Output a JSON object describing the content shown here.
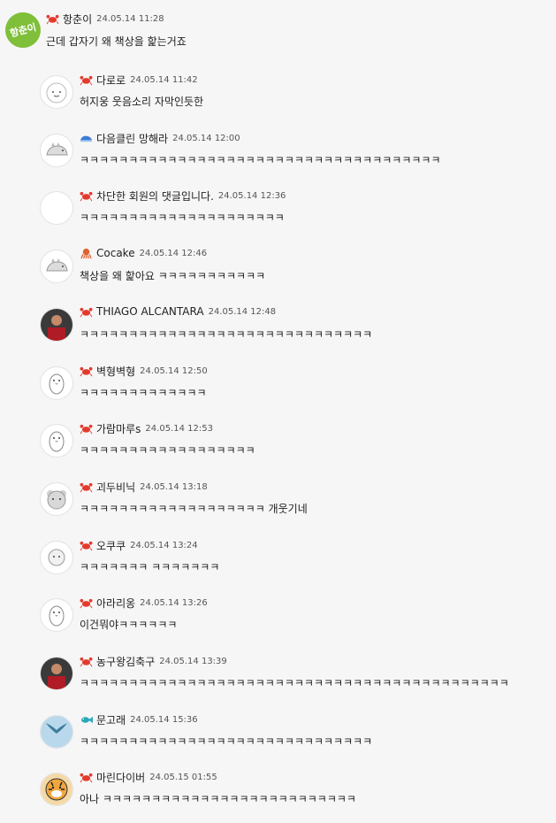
{
  "root": {
    "nick": "항춘이",
    "time": "24.05.14 11:28",
    "text": "근데 갑자기 왜 책상을 핥는거죠",
    "avatar_text": "항춘이",
    "badge": "crab-icon"
  },
  "replies": [
    {
      "nick": "다로로",
      "time": "24.05.14 11:42",
      "text": "허지웅 웃음소리 자막인듯한",
      "badge": "crab-icon",
      "avatar": "default-face-avatar"
    },
    {
      "nick": "다음클린 망해라",
      "time": "24.05.14 12:00",
      "text": "ㅋㅋㅋㅋㅋㅋㅋㅋㅋㅋㅋㅋㅋㅋㅋㅋㅋㅋㅋㅋㅋㅋㅋㅋㅋㅋㅋㅋㅋㅋㅋㅋㅋㅋㅋㅋㅋ",
      "badge": "whale-icon",
      "avatar": "dino-avatar"
    },
    {
      "nick": "차단한 회원의 댓글입니다.",
      "time": "24.05.14 12:36",
      "text": "ㅋㅋㅋㅋㅋㅋㅋㅋㅋㅋㅋㅋㅋㅋㅋㅋㅋㅋㅋㅋㅋ",
      "badge": "crab-icon",
      "avatar": "blank-avatar"
    },
    {
      "nick": "Cocake",
      "time": "24.05.14 12:46",
      "text": "책상을 왜 핥아요 ㅋㅋㅋㅋㅋㅋㅋㅋㅋㅋㅋ",
      "badge": "octopus-icon",
      "avatar": "dino-avatar"
    },
    {
      "nick": "THIAGO ALCANTARA",
      "time": "24.05.14 12:48",
      "text": "ㅋㅋㅋㅋㅋㅋㅋㅋㅋㅋㅋㅋㅋㅋㅋㅋㅋㅋㅋㅋㅋㅋㅋㅋㅋㅋㅋㅋㅋㅋ",
      "badge": "crab-icon",
      "avatar": "photo-avatar"
    },
    {
      "nick": "벽형벽형",
      "time": "24.05.14 12:50",
      "text": "ㅋㅋㅋㅋㅋㅋㅋㅋㅋㅋㅋㅋㅋ",
      "badge": "crab-icon",
      "avatar": "penguin-avatar"
    },
    {
      "nick": "가람마루s",
      "time": "24.05.14 12:53",
      "text": "ㅋㅋㅋㅋㅋㅋㅋㅋㅋㅋㅋㅋㅋㅋㅋㅋㅋㅋ",
      "badge": "crab-icon",
      "avatar": "penguin-avatar"
    },
    {
      "nick": "괴두비닉",
      "time": "24.05.14 13:18",
      "text": "ㅋㅋㅋㅋㅋㅋㅋㅋㅋㅋㅋㅋㅋㅋㅋㅋㅋㅋㅋ 개웃기네",
      "badge": "crab-icon",
      "avatar": "bear-avatar"
    },
    {
      "nick": "오쿠쿠",
      "time": "24.05.14 13:24",
      "text": "ㅋㅋㅋㅋㅋㅋㅋ ㅋㅋㅋㅋㅋㅋㅋ",
      "badge": "crab-icon",
      "avatar": "sheep-avatar"
    },
    {
      "nick": "아라리옹",
      "time": "24.05.14 13:26",
      "text": "이건뭐야ㅋㅋㅋㅋㅋㅋ",
      "badge": "crab-icon",
      "avatar": "penguin-avatar"
    },
    {
      "nick": "농구왕김축구",
      "time": "24.05.14 13:39",
      "text": "ㅋㅋㅋㅋㅋㅋㅋㅋㅋㅋㅋㅋㅋㅋㅋㅋㅋㅋㅋㅋㅋㅋㅋㅋㅋㅋㅋㅋㅋㅋㅋㅋㅋㅋㅋㅋㅋㅋㅋㅋㅋㅋㅋㅋ",
      "badge": "crab-icon",
      "avatar": "photo-avatar"
    },
    {
      "nick": "문고래",
      "time": "24.05.14 15:36",
      "text": "ㅋㅋㅋㅋㅋㅋㅋㅋㅋㅋㅋㅋㅋㅋㅋㅋㅋㅋㅋㅋㅋㅋㅋㅋㅋㅋㅋㅋㅋㅋ",
      "badge": "fish-icon",
      "avatar": "whale-tail-avatar"
    },
    {
      "nick": "마린다이버",
      "time": "24.05.15 01:55",
      "text": "아나 ㅋㅋㅋㅋㅋㅋㅋㅋㅋㅋㅋㅋㅋㅋㅋㅋㅋㅋㅋㅋㅋㅋㅋㅋㅋㅋ",
      "badge": "crab-icon",
      "avatar": "tiger-avatar"
    }
  ],
  "colors": {
    "crab": "#e23b2e",
    "whale": "#3b7bd6",
    "octopus": "#e06030",
    "fish": "#2aa8b8",
    "root_avatar": "#7fbf3a"
  }
}
